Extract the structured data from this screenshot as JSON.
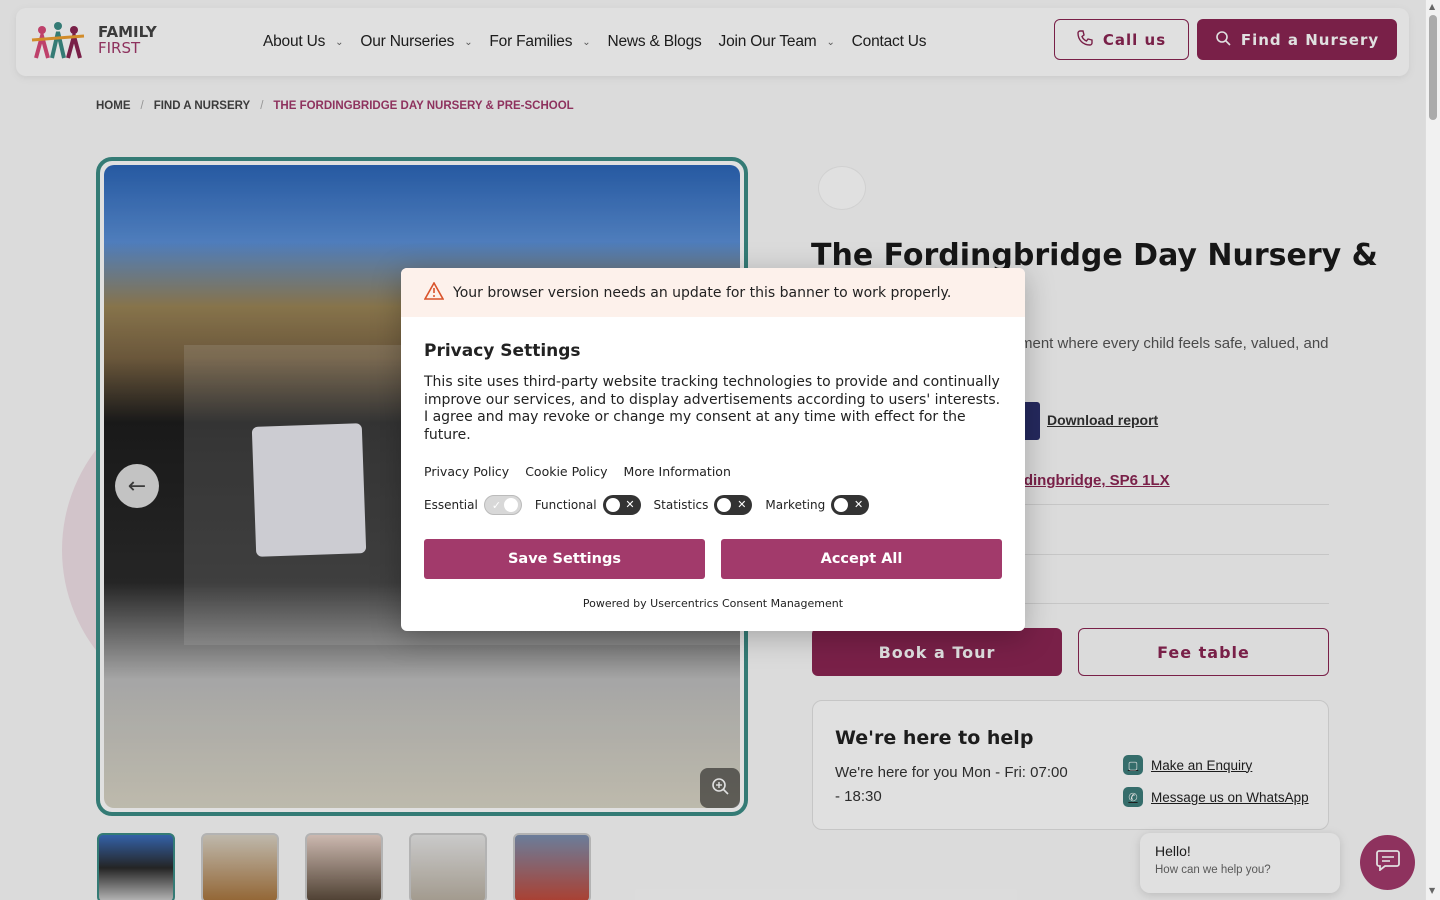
{
  "header": {
    "logo": {
      "line1": "FAMILY",
      "line2": "FIRST"
    },
    "nav": [
      {
        "label": "About Us",
        "has_dropdown": true
      },
      {
        "label": "Our Nurseries",
        "has_dropdown": true
      },
      {
        "label": "For Families",
        "has_dropdown": true
      },
      {
        "label": "News & Blogs",
        "has_dropdown": false
      },
      {
        "label": "Join Our Team",
        "has_dropdown": true
      },
      {
        "label": "Contact Us",
        "has_dropdown": false
      }
    ],
    "call_label": "Call us",
    "find_label": "Find a Nursery"
  },
  "breadcrumb": {
    "items": [
      "HOME",
      "FIND A NURSERY"
    ],
    "current": "THE FORDINGBRIDGE DAY NURSERY & PRE-SCHOOL",
    "separator": "/"
  },
  "nursery": {
    "title": "The Fordingbridge Day Nursery &",
    "description_partial": "ment where every child feels safe, valued, and",
    "download_label": "Download report",
    "address_partial": "rdingbridge, SP6 1LX",
    "book_tour_label": "Book a Tour",
    "fee_table_label": "Fee table"
  },
  "help": {
    "title": "We're here to help",
    "hours": "We're here for you Mon - Fri: 07:00 - 18:30",
    "enquiry_label": "Make an Enquiry",
    "whatsapp_label": "Message us on WhatsApp"
  },
  "chat": {
    "greeting": "Hello!",
    "prompt": "How can we help you?"
  },
  "consent": {
    "warning": "Your browser version needs an update for this banner to work properly.",
    "title": "Privacy Settings",
    "text": "This site uses third-party website tracking technologies to provide and continually improve our services, and to display advertisements according to users' interests. I agree and may revoke or change my consent at any time with effect for the future.",
    "links": [
      "Privacy Policy",
      "Cookie Policy",
      "More Information"
    ],
    "toggles": [
      {
        "label": "Essential",
        "on": true
      },
      {
        "label": "Functional",
        "on": false
      },
      {
        "label": "Statistics",
        "on": false
      },
      {
        "label": "Marketing",
        "on": false
      }
    ],
    "save_label": "Save Settings",
    "accept_label": "Accept All",
    "powered_by": "Powered by Usercentrics Consent Management"
  },
  "colors": {
    "brand": "#8a2553",
    "accent": "#a23a6b",
    "teal": "#3c8c86",
    "warning_bg": "#fdf1eb"
  },
  "icons": {
    "call": "phone-icon",
    "find": "search-icon",
    "prev": "arrow-left-icon",
    "zoom": "zoom-in-icon",
    "warning": "warning-triangle-icon",
    "chat": "chat-icon"
  }
}
